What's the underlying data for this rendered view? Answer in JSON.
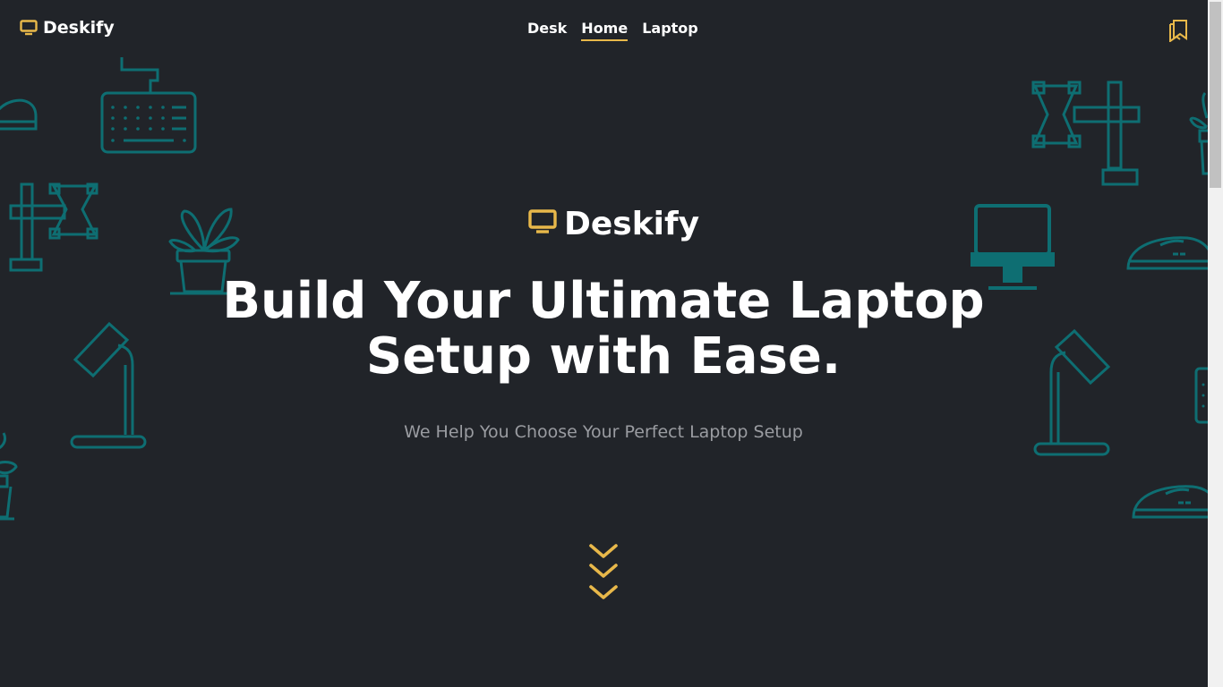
{
  "app": {
    "brand_name": "Deskify"
  },
  "nav": {
    "items": [
      {
        "label": "Desk",
        "active": false
      },
      {
        "label": "Home",
        "active": true
      },
      {
        "label": "Laptop",
        "active": false
      }
    ]
  },
  "hero": {
    "logo_text": "Deskify",
    "headline_line1": "Build Your Ultimate Laptop",
    "headline_line2": "Setup with Ease.",
    "subheadline": "We Help You Choose Your Perfect Laptop Setup"
  },
  "icons": {
    "brand": "monitor-icon",
    "bookmark": "bookmark-icon",
    "scroll": "chevrons-down-icon"
  },
  "colors": {
    "background": "#212429",
    "accent": "#e8b84a",
    "decoration": "#0e6e72",
    "text": "#ffffff",
    "muted": "#9a9ca1"
  }
}
